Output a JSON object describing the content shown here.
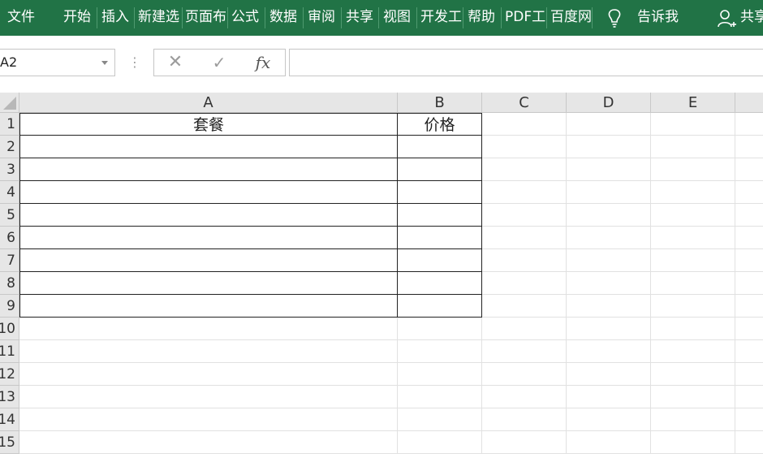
{
  "ribbon": {
    "tabs": [
      "文件",
      "开始",
      "插入",
      "新建选",
      "页面布",
      "公式",
      "数据",
      "审阅",
      "共享",
      "视图",
      "开发工",
      "帮助",
      "PDF工",
      "百度网"
    ],
    "tell_me": "告诉我",
    "share": "共享"
  },
  "formula_bar": {
    "name_box": "A2",
    "cancel_symbol": "✕",
    "enter_symbol": "✓",
    "fx_symbol": "fx",
    "formula": ""
  },
  "sheet": {
    "columns": [
      "A",
      "B",
      "C",
      "D",
      "E"
    ],
    "rows": [
      "1",
      "2",
      "3",
      "4",
      "5",
      "6",
      "7",
      "8",
      "9",
      "10",
      "11",
      "12",
      "13",
      "14",
      "15"
    ],
    "cells": {
      "A1": "套餐",
      "B1": "价格"
    },
    "bordered_range": "A1:B9"
  }
}
